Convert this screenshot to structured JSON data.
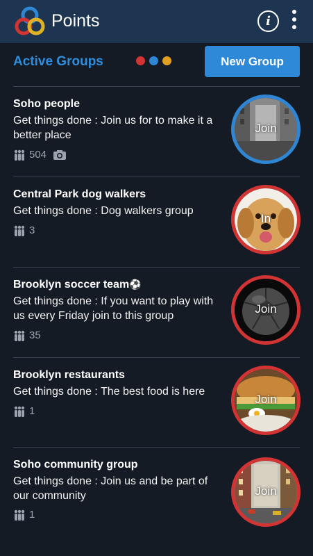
{
  "app": {
    "title": "Points",
    "info_icon": "i",
    "logo_colors": [
      "#2e86d4",
      "#e0b324",
      "#d23333"
    ]
  },
  "header": {
    "section_title": "Active Groups",
    "dot_colors": [
      "#d23333",
      "#2e86d4",
      "#e0a020"
    ],
    "new_group_label": "New Group"
  },
  "groups": [
    {
      "title": "Soho people",
      "description": "Get things done : Join us for to make it a better place",
      "members": "504",
      "has_camera": true,
      "join_label": "Join",
      "ring_color": "blue"
    },
    {
      "title": "Central Park dog walkers",
      "description": "Get things done : Dog walkers group",
      "members": "3",
      "join_label": "In",
      "ring_color": "red"
    },
    {
      "title": "Brooklyn soccer team",
      "title_emoji": "⚽",
      "description": "Get things done : If you want to play with us every Friday join to this group",
      "members": "35",
      "join_label": "Join",
      "ring_color": "red"
    },
    {
      "title": "Brooklyn restaurants",
      "description": "Get things done : The best food is here",
      "members": "1",
      "join_label": "Join",
      "ring_color": "red"
    },
    {
      "title": "Soho community group",
      "description": "Get things done : Join us and be part of our community",
      "members": "1",
      "join_label": "Join",
      "ring_color": "red"
    }
  ]
}
